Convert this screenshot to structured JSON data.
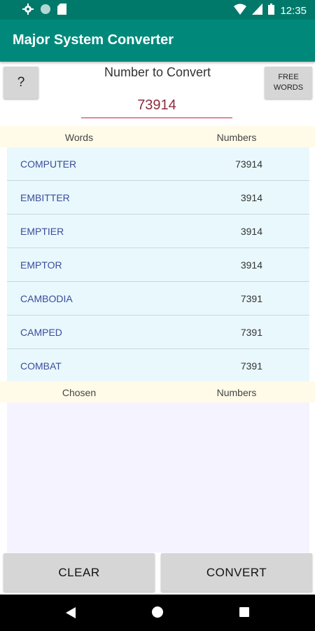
{
  "status_bar": {
    "time": "12:35",
    "icons": [
      "gear-icon",
      "circle-icon",
      "sd-card-icon",
      "wifi-icon",
      "signal-icon",
      "battery-icon"
    ]
  },
  "app_bar": {
    "title": "Major System Converter"
  },
  "help_button": {
    "label": "?"
  },
  "free_words_button": {
    "label": "FREE\nWORDS"
  },
  "number_input": {
    "label": "Number to Convert",
    "value": "73914"
  },
  "words_header": {
    "left": "Words",
    "right": "Numbers"
  },
  "words": [
    {
      "word": "COMPUTER",
      "number": "73914"
    },
    {
      "word": "EMBITTER",
      "number": "3914"
    },
    {
      "word": "EMPTIER",
      "number": "3914"
    },
    {
      "word": "EMPTOR",
      "number": "3914"
    },
    {
      "word": "CAMBODIA",
      "number": "7391"
    },
    {
      "word": "CAMPED",
      "number": "7391"
    },
    {
      "word": "COMBAT",
      "number": "7391"
    }
  ],
  "chosen_header": {
    "left": "Chosen",
    "right": "Numbers"
  },
  "buttons": {
    "clear": "CLEAR",
    "convert": "CONVERT"
  },
  "colors": {
    "primary": "#00897b",
    "status": "#00796b",
    "accent": "#e2889b",
    "word_text": "#3b4c9b"
  }
}
